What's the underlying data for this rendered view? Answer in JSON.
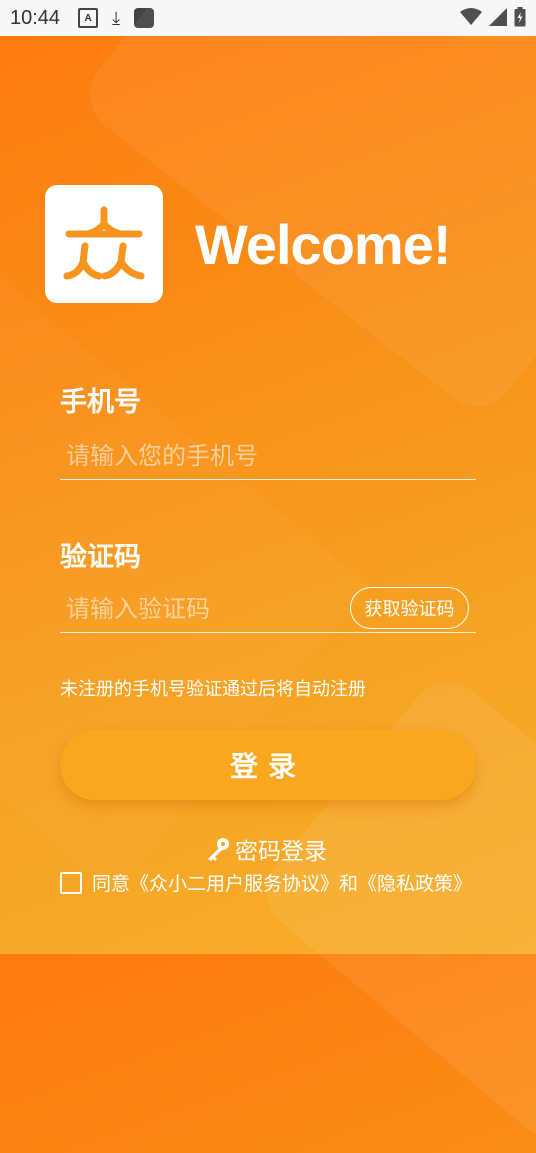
{
  "status_bar": {
    "time": "10:44",
    "icons": [
      "accessibility-icon",
      "download-icon",
      "app-icon",
      "wifi-icon",
      "signal-icon",
      "battery-icon"
    ]
  },
  "header": {
    "welcome": "Welcome!"
  },
  "form": {
    "phone_label": "手机号",
    "phone_placeholder": "请输入您的手机号",
    "code_label": "验证码",
    "code_placeholder": "请输入验证码",
    "get_code_label": "获取验证码",
    "hint": "未注册的手机号验证通过后将自动注册",
    "login_label": "登录",
    "password_login_label": "密码登录",
    "agree_prefix": "同意",
    "service_link": "《众小二用户服务协议》",
    "agree_and": "和",
    "privacy_link": "《隐私政策》"
  },
  "colors": {
    "bg_top": "#FF7A0F",
    "bg_bottom": "#F8AE2A",
    "button": "#F8A71E",
    "logo": "#F7941E"
  }
}
